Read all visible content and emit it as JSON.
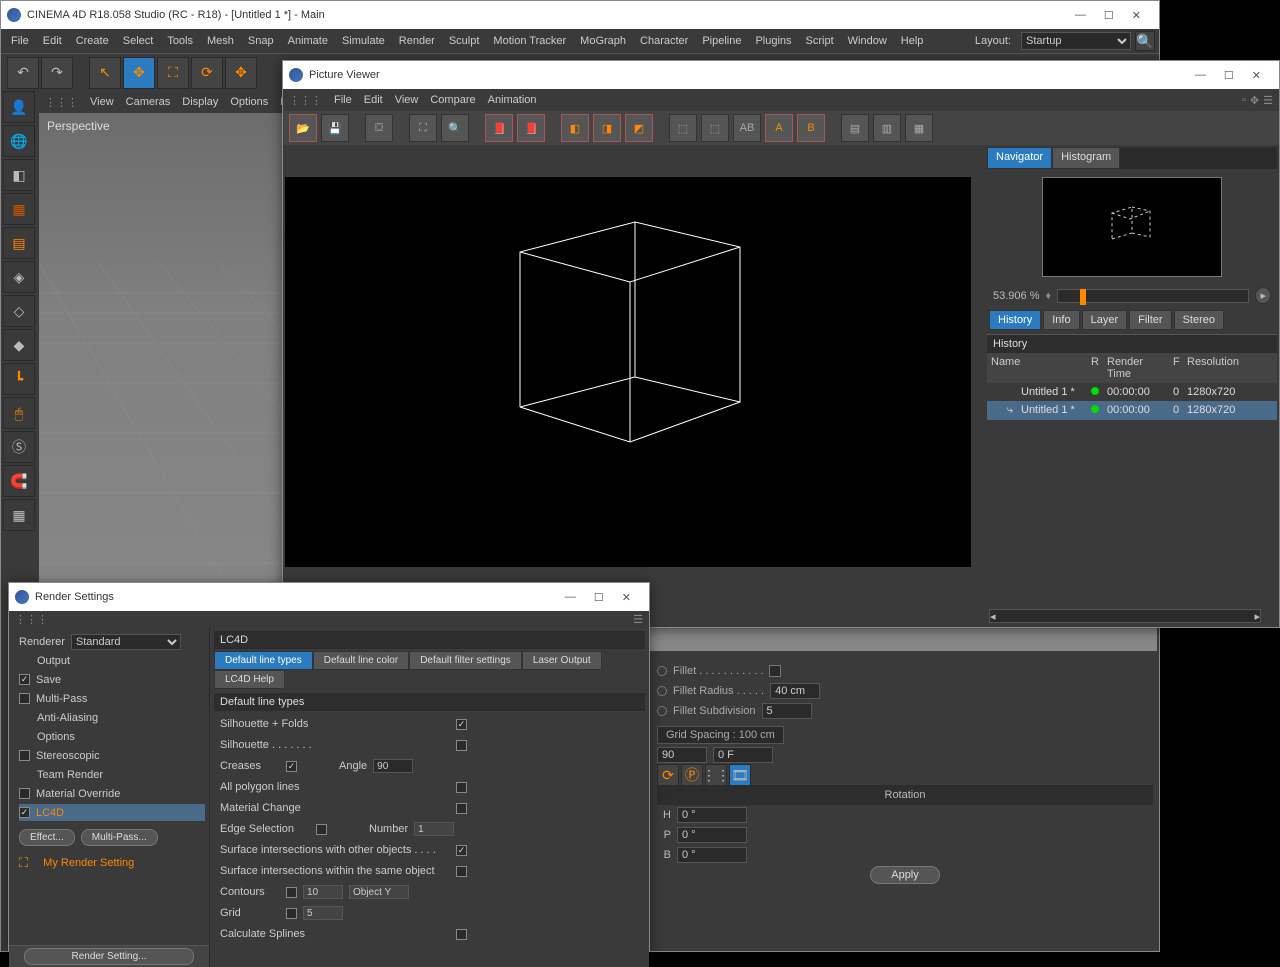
{
  "main_window": {
    "title": "CINEMA 4D R18.058 Studio (RC - R18) - [Untitled 1 *] - Main"
  },
  "main_menu": [
    "File",
    "Edit",
    "Create",
    "Select",
    "Tools",
    "Mesh",
    "Snap",
    "Animate",
    "Simulate",
    "Render",
    "Sculpt",
    "Motion Tracker",
    "MoGraph",
    "Character",
    "Pipeline",
    "Plugins",
    "Script",
    "Window",
    "Help"
  ],
  "layout": {
    "label": "Layout:",
    "value": "Startup"
  },
  "viewport_menu": [
    "View",
    "Cameras",
    "Display",
    "Options",
    "Fil"
  ],
  "viewport_label": "Perspective",
  "picture_viewer": {
    "title": "Picture Viewer",
    "menu": [
      "File",
      "Edit",
      "View",
      "Compare",
      "Animation"
    ],
    "nav_tabs": [
      "Navigator",
      "Histogram"
    ],
    "zoom": "53.906 %",
    "tabs2": [
      "History",
      "Info",
      "Layer",
      "Filter",
      "Stereo"
    ],
    "history_label": "History",
    "history_cols": [
      "Name",
      "R",
      "Render Time",
      "F",
      "Resolution"
    ],
    "history_rows": [
      {
        "name": "Untitled 1 *",
        "rt": "00:00:00",
        "f": "0",
        "res": "1280x720",
        "sel": false
      },
      {
        "name": "Untitled 1 *",
        "rt": "00:00:00",
        "f": "0",
        "res": "1280x720",
        "sel": true
      }
    ]
  },
  "render_settings": {
    "title": "Render Settings",
    "renderer_label": "Renderer",
    "renderer_value": "Standard",
    "left_items": [
      "Output",
      "Save",
      "Multi-Pass",
      "Anti-Aliasing",
      "Options",
      "Stereoscopic",
      "Team Render",
      "Material Override",
      "LC4D"
    ],
    "buttons": [
      "Effect...",
      "Multi-Pass..."
    ],
    "my_setting": "My Render Setting",
    "footer": "Render Setting...",
    "panel_title": "LC4D",
    "tabs": [
      "Default line types",
      "Default line color",
      "Default filter settings",
      "Laser Output",
      "LC4D Help"
    ],
    "section": "Default line types",
    "rows": {
      "silhouette_folds": "Silhouette + Folds",
      "silhouette": "Silhouette . . . . . . .",
      "creases": "Creases",
      "angle_label": "Angle",
      "angle_value": "90",
      "all_polygon": "All polygon lines",
      "material_change": "Material Change",
      "edge_selection": "Edge Selection",
      "number_label": "Number",
      "number_value": "1",
      "surf_other": "Surface intersections with other objects . . . .",
      "surf_same": "Surface intersections within the same object",
      "contours": "Contours",
      "contours_value": "10",
      "contours_axis": "Object Y",
      "grid": "Grid",
      "grid_value": "5",
      "calc_splines": "Calculate Splines"
    }
  },
  "attrs": {
    "fillet": "Fillet . . . . . . . . . . .",
    "fillet_radius": "Fillet Radius . . . . .",
    "fillet_radius_value": "40 cm",
    "fillet_sub": "Fillet Subdivision",
    "fillet_sub_value": "5",
    "grid_spacing": "Grid Spacing : 100 cm",
    "angle90": "90",
    "zeroF": "0 F",
    "rotation": "Rotation",
    "h": "H",
    "p": "P",
    "b": "B",
    "zero_deg": "0 °",
    "apply": "Apply"
  }
}
